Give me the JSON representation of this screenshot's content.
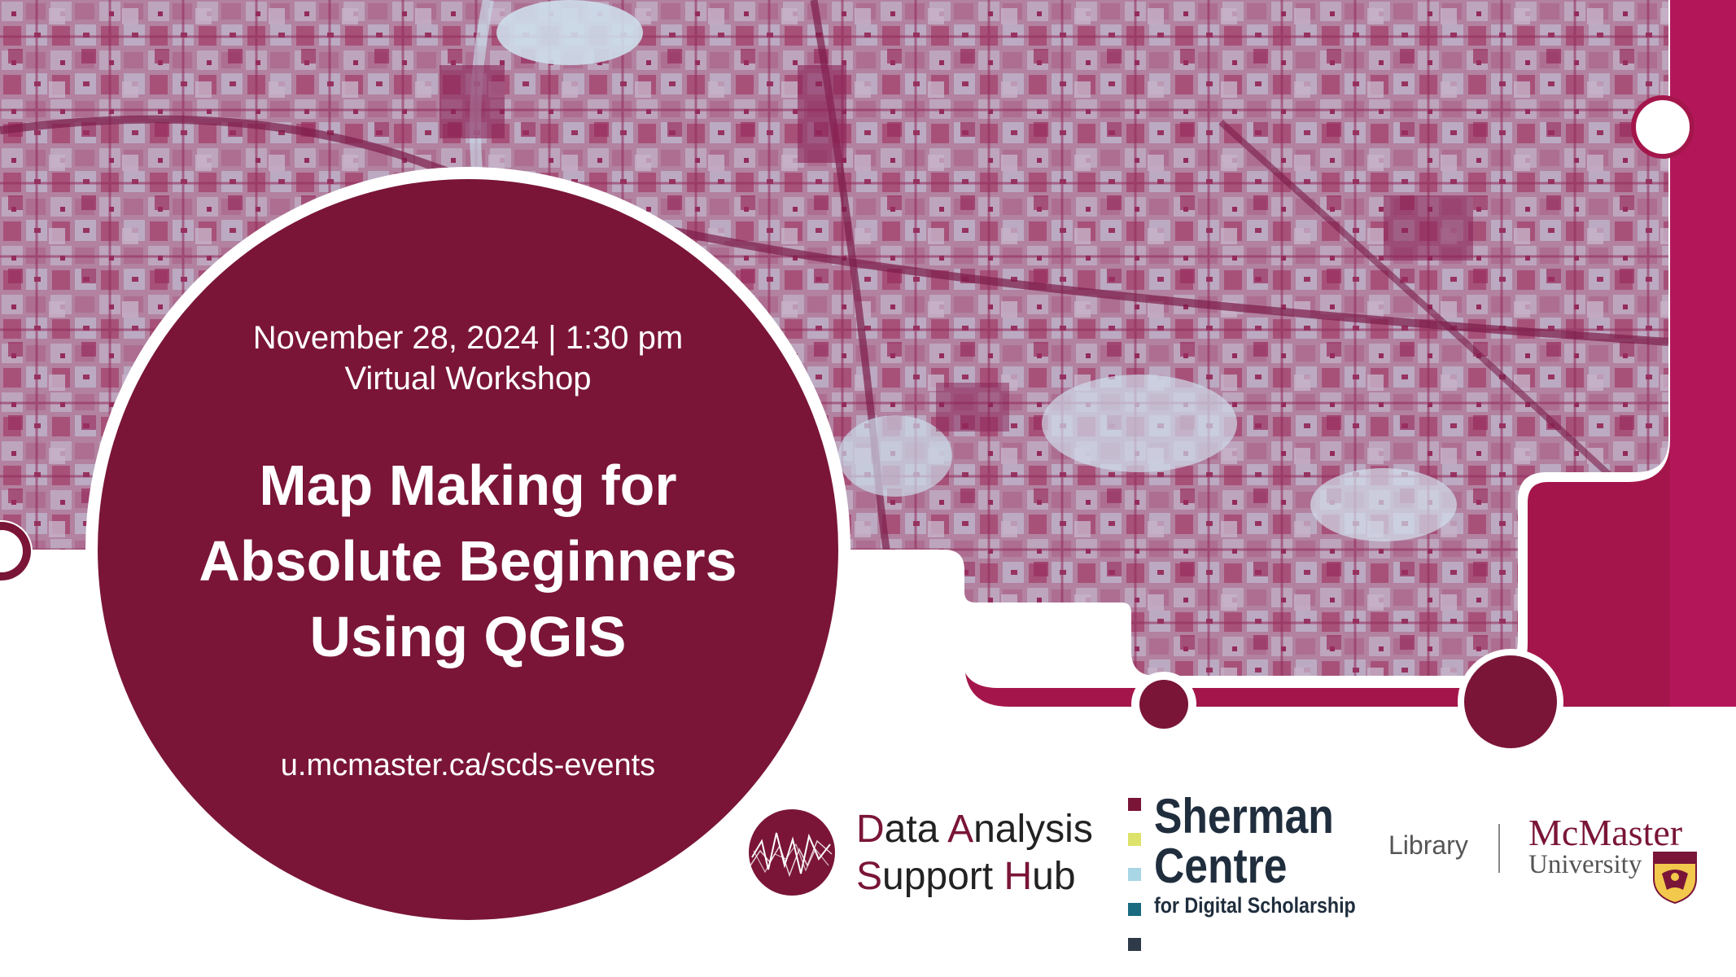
{
  "event": {
    "date_time": "November 28, 2024 | 1:30 pm",
    "format": "Virtual Workshop",
    "title_lines": [
      "Map Making for",
      "Absolute Beginners",
      "Using QGIS"
    ],
    "url": "u.mcmaster.ca/scds-events"
  },
  "logos": {
    "dash": {
      "line1": {
        "c1": "D",
        "t1": "ata ",
        "c2": "A",
        "t2": "nalysis"
      },
      "line2": {
        "c1": "S",
        "t1": "upport ",
        "c2": "H",
        "t2": "ub"
      }
    },
    "sherman": {
      "line1": "Sherman",
      "line2": "Centre",
      "line3": "for Digital Scholarship",
      "bar_colors": [
        "#7a1538",
        "#dde36a",
        "#a9d6e5",
        "#1a6a80",
        "#2e3a47"
      ]
    },
    "library": "Library",
    "mcmaster": {
      "name": "McMaster",
      "univ": "University"
    }
  },
  "colors": {
    "maroon": "#7a1538",
    "magenta": "#a4164b",
    "map_light": "#c7d6e6",
    "map_dark": "#a23a66"
  },
  "icons": {
    "dash_logo": "data-analysis-wave-icon",
    "mcmaster_crest": "mcmaster-crest-icon"
  }
}
